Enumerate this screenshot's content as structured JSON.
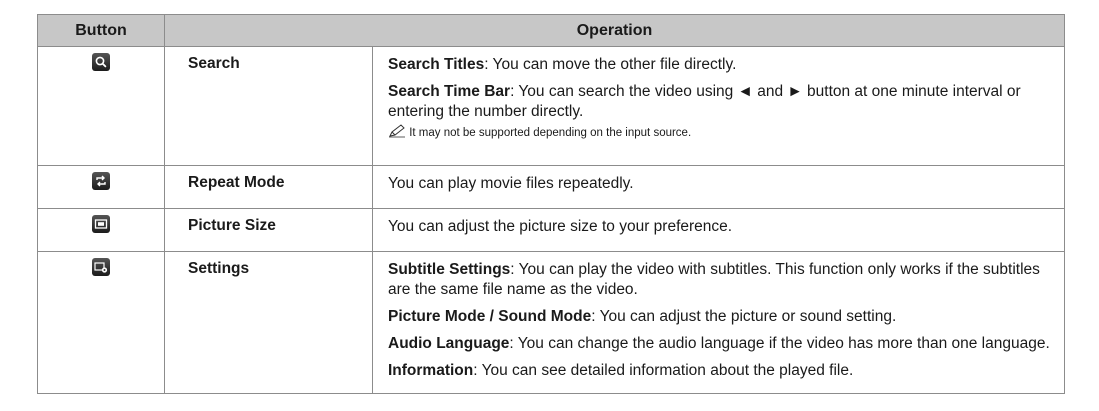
{
  "header": {
    "col_button": "Button",
    "col_operation": "Operation"
  },
  "rows": [
    {
      "icon": "search-icon",
      "name": "Search",
      "items": [
        {
          "term": "Search Titles",
          "text": ": You can move the other file directly."
        },
        {
          "term": "Search Time Bar",
          "text": ": You can search the video using ◄ and ► button at one minute interval or entering the number directly."
        }
      ],
      "note": "It may not be supported depending on the input source."
    },
    {
      "icon": "repeat-icon",
      "name": "Repeat Mode",
      "text": "You can play movie files repeatedly."
    },
    {
      "icon": "picture-size-icon",
      "name": "Picture Size",
      "text": "You can adjust the picture size to your preference."
    },
    {
      "icon": "settings-icon",
      "name": "Settings",
      "items": [
        {
          "term": "Subtitle Settings",
          "text": ": You can play the video with subtitles. This function only works if the subtitles are the same file name as the video."
        },
        {
          "term": "Picture Mode / Sound Mode",
          "text": ": You can adjust the picture or sound setting."
        },
        {
          "term": "Audio Language",
          "text": ": You can change the audio language if the video has more than one language."
        },
        {
          "term": "Information",
          "text": ": You can see detailed information about the played file."
        }
      ]
    }
  ]
}
